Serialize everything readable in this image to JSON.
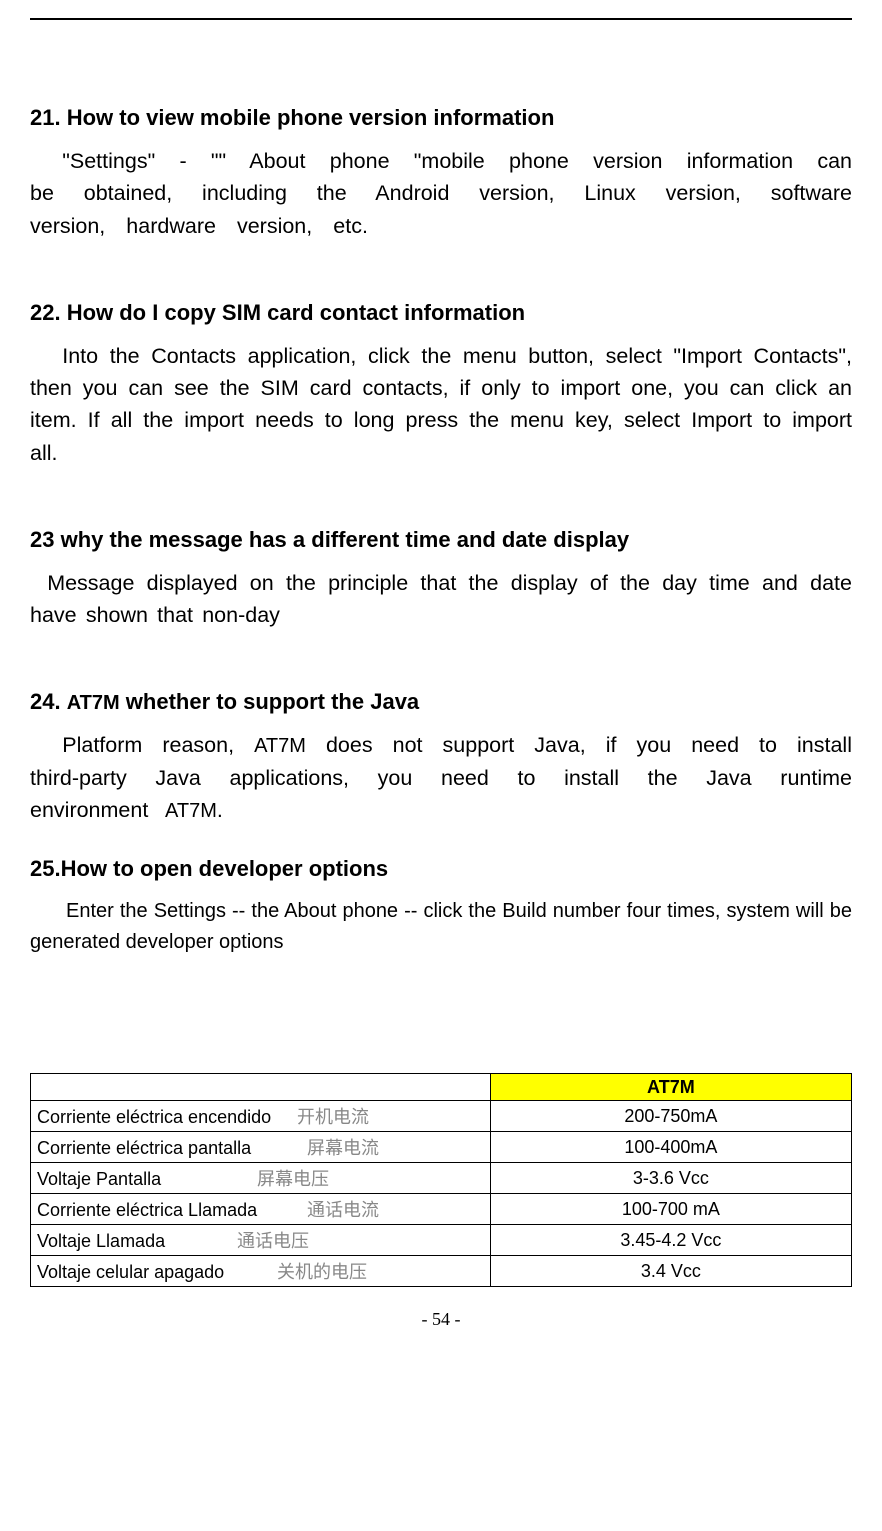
{
  "sections": [
    {
      "heading": "21. How to view mobile phone version information",
      "body": "\"Settings\" - \"\" About phone \"mobile phone version information can be obtained, including the Android version, Linux version, software version, hardware version, etc."
    },
    {
      "heading": "22. How do I copy SIM card contact information",
      "body": "Into the Contacts application, click the menu button, select \"Import Contacts\", then you can see the SIM card contacts, if only to import one, you can click an item. If all the import needs to long press the menu key, select Import to import all."
    },
    {
      "heading": "23 why the message has a different time and date display",
      "body": "Message displayed on the principle that the display of the day time and date have shown that non-day"
    },
    {
      "heading_prefix": "24. ",
      "heading_model": "AT7M",
      "heading_suffix": " whether to support the Java",
      "body_prefix": "Platform reason, ",
      "body_model": "AT7M",
      "body_mid": " does not support Java, if you need to install third-party Java applications, you need to install the Java runtime environment ",
      "body_trail_model": "AT7M",
      "body_trail_suffix": "."
    },
    {
      "heading": "25.How to open developer options",
      "body": "Enter the Settings -- the About phone -- click the Build number four times, system will be generated developer options"
    }
  ],
  "table": {
    "header": "AT7M",
    "rows": [
      {
        "es": "Corriente eléctrica encendido",
        "cjk": "开机电流",
        "value": "200-750mA"
      },
      {
        "es": "Corriente eléctrica pantalla",
        "cjk": "屏幕电流",
        "value": "100-400mA"
      },
      {
        "es": "Voltaje Pantalla",
        "cjk": "屏幕电压",
        "value": "3-3.6 Vcc"
      },
      {
        "es": "Corriente eléctrica Llamada",
        "cjk": "通话电流",
        "value": "100-700 mA"
      },
      {
        "es": "Voltaje Llamada",
        "cjk": "通话电压",
        "value": "3.45-4.2 Vcc"
      },
      {
        "es": "Voltaje celular apagado",
        "cjk": "关机的电压",
        "value": "3.4 Vcc"
      }
    ]
  },
  "page_number": "- 54 -"
}
